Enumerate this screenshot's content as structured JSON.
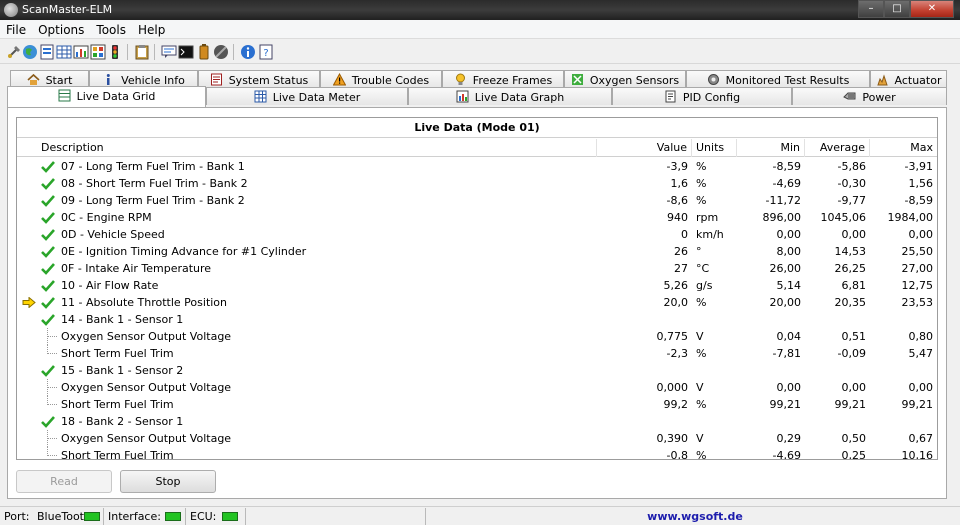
{
  "window": {
    "title": "ScanMaster-ELM"
  },
  "menu": [
    "File",
    "Options",
    "Tools",
    "Help"
  ],
  "tabs_row1": [
    {
      "label": "Start",
      "icon": "home-icon"
    },
    {
      "label": "Vehicle Info",
      "icon": "info-icon"
    },
    {
      "label": "System Status",
      "icon": "document-icon"
    },
    {
      "label": "Trouble Codes",
      "icon": "warning-icon"
    },
    {
      "label": "Freeze Frames",
      "icon": "lamp-icon"
    },
    {
      "label": "Oxygen Sensors",
      "icon": "sensor-icon"
    },
    {
      "label": "Monitored Test Results",
      "icon": "gear-icon"
    },
    {
      "label": "Actuator",
      "icon": "actuator-icon"
    }
  ],
  "tabs_row2": [
    {
      "label": "Live Data Grid",
      "icon": "grid-icon",
      "active": true
    },
    {
      "label": "Live Data Meter",
      "icon": "meter-icon"
    },
    {
      "label": "Live Data Graph",
      "icon": "graph-icon"
    },
    {
      "label": "PID Config",
      "icon": "config-icon"
    },
    {
      "label": "Power",
      "icon": "power-icon"
    }
  ],
  "grid": {
    "title": "Live Data (Mode 01)",
    "columns": [
      "Description",
      "Value",
      "Units",
      "Min",
      "Average",
      "Max"
    ],
    "rows": [
      {
        "desc": "07 - Long Term Fuel Trim - Bank 1",
        "value": "-3,9",
        "units": "%",
        "min": "-8,59",
        "avg": "-5,86",
        "max": "-3,91",
        "check": true
      },
      {
        "desc": "08 - Short Term Fuel Trim - Bank 2",
        "value": "1,6",
        "units": "%",
        "min": "-4,69",
        "avg": "-0,30",
        "max": "1,56",
        "check": true
      },
      {
        "desc": "09 - Long Term Fuel Trim - Bank 2",
        "value": "-8,6",
        "units": "%",
        "min": "-11,72",
        "avg": "-9,77",
        "max": "-8,59",
        "check": true
      },
      {
        "desc": "0C - Engine RPM",
        "value": "940",
        "units": "rpm",
        "min": "896,00",
        "avg": "1045,06",
        "max": "1984,00",
        "check": true
      },
      {
        "desc": "0D - Vehicle Speed",
        "value": "0",
        "units": "km/h",
        "min": "0,00",
        "avg": "0,00",
        "max": "0,00",
        "check": true
      },
      {
        "desc": "0E - Ignition Timing Advance for #1 Cylinder",
        "value": "26",
        "units": "°",
        "min": "8,00",
        "avg": "14,53",
        "max": "25,50",
        "check": true
      },
      {
        "desc": "0F - Intake Air Temperature",
        "value": "27",
        "units": "°C",
        "min": "26,00",
        "avg": "26,25",
        "max": "27,00",
        "check": true
      },
      {
        "desc": "10 - Air Flow Rate",
        "value": "5,26",
        "units": "g/s",
        "min": "5,14",
        "avg": "6,81",
        "max": "12,75",
        "check": true
      },
      {
        "desc": "11 - Absolute Throttle Position",
        "value": "20,0",
        "units": "%",
        "min": "20,00",
        "avg": "20,35",
        "max": "23,53",
        "check": true,
        "selected": true
      },
      {
        "desc": "14 - Bank 1 - Sensor 1",
        "value": "",
        "units": "",
        "min": "",
        "avg": "",
        "max": "",
        "check": true
      },
      {
        "desc": "Oxygen Sensor Output Voltage",
        "value": "0,775",
        "units": "V",
        "min": "0,04",
        "avg": "0,51",
        "max": "0,80",
        "child": true
      },
      {
        "desc": "Short Term Fuel Trim",
        "value": "-2,3",
        "units": "%",
        "min": "-7,81",
        "avg": "-0,09",
        "max": "5,47",
        "child": true,
        "last": true
      },
      {
        "desc": "15 - Bank 1 - Sensor 2",
        "value": "",
        "units": "",
        "min": "",
        "avg": "",
        "max": "",
        "check": true
      },
      {
        "desc": "Oxygen Sensor Output Voltage",
        "value": "0,000",
        "units": "V",
        "min": "0,00",
        "avg": "0,00",
        "max": "0,00",
        "child": true
      },
      {
        "desc": "Short Term Fuel Trim",
        "value": "99,2",
        "units": "%",
        "min": "99,21",
        "avg": "99,21",
        "max": "99,21",
        "child": true,
        "last": true
      },
      {
        "desc": "18 - Bank 2 - Sensor 1",
        "value": "",
        "units": "",
        "min": "",
        "avg": "",
        "max": "",
        "check": true
      },
      {
        "desc": "Oxygen Sensor Output Voltage",
        "value": "0,390",
        "units": "V",
        "min": "0,29",
        "avg": "0,50",
        "max": "0,67",
        "child": true
      },
      {
        "desc": "Short Term Fuel Trim",
        "value": "-0,8",
        "units": "%",
        "min": "-4,69",
        "avg": "0,25",
        "max": "10,16",
        "child": true,
        "last": true
      }
    ]
  },
  "buttons": {
    "read": "Read",
    "stop": "Stop"
  },
  "status": {
    "port_label": "Port:",
    "port_value": "BlueTooth",
    "interface_label": "Interface:",
    "ecu_label": "ECU:",
    "website": "www.wgsoft.de"
  },
  "colors": {
    "led_on": "#22c322",
    "check": "#2aa52a",
    "arrow": "#ffd400",
    "link": "#1d1dad"
  }
}
